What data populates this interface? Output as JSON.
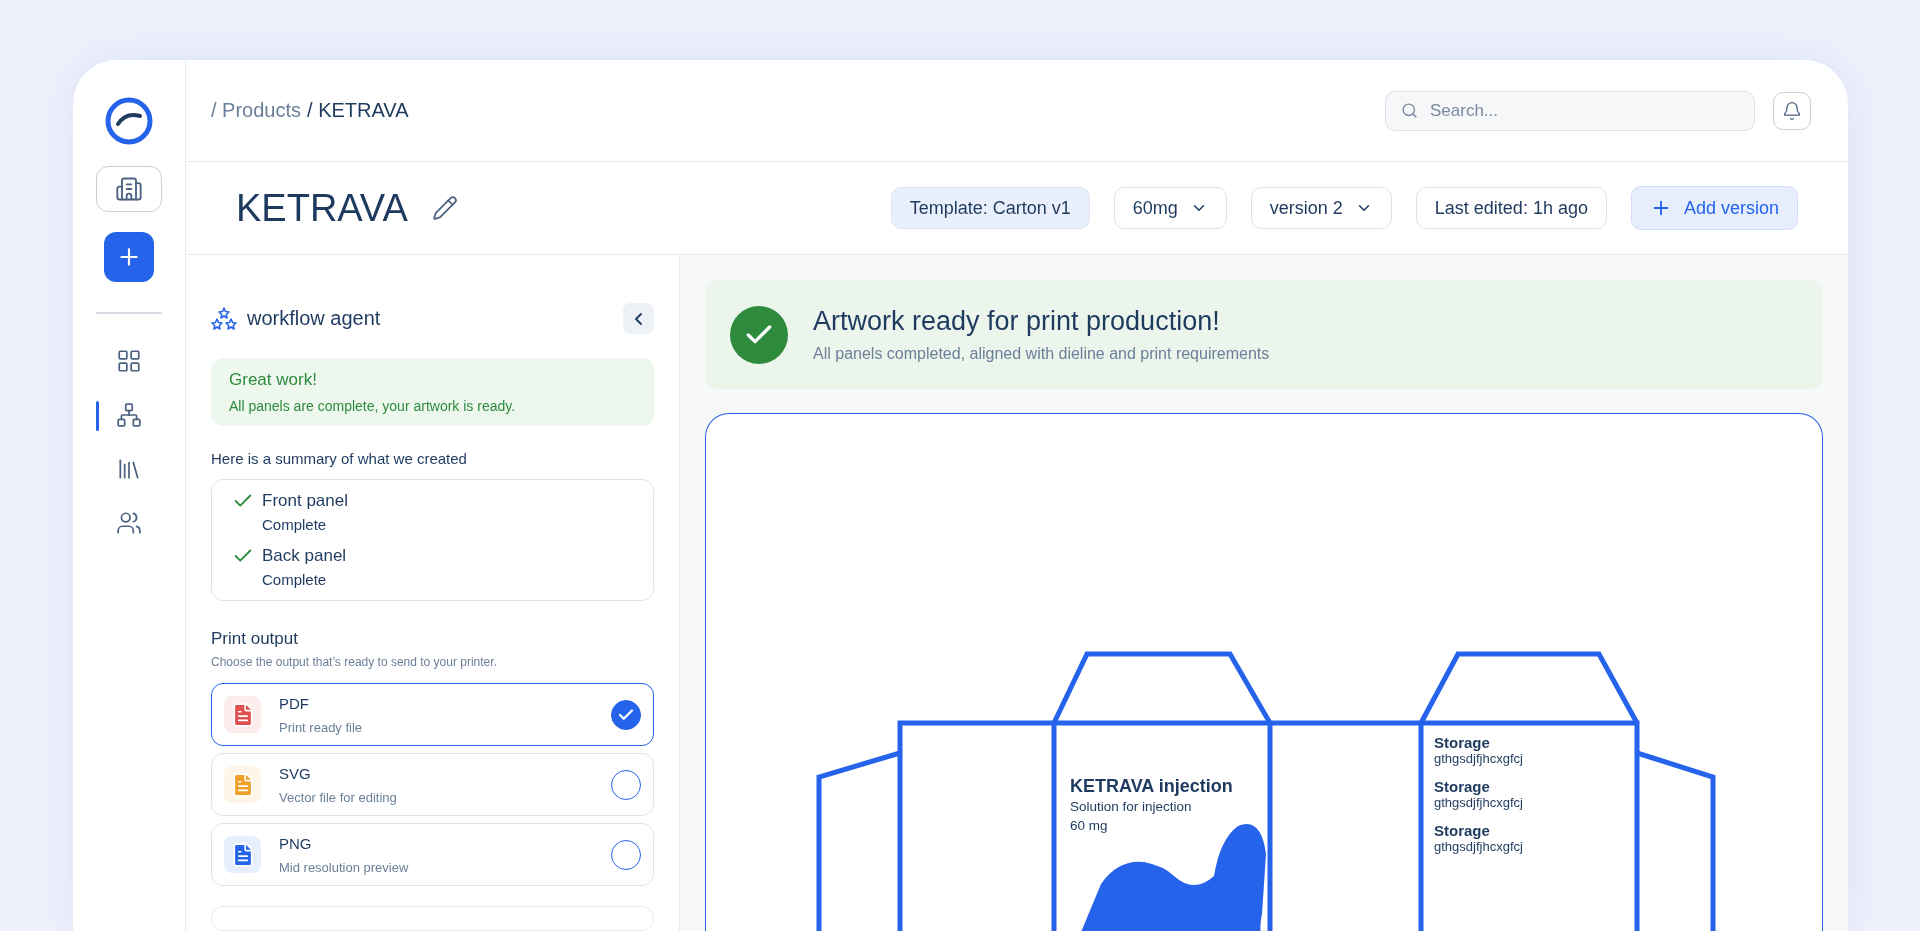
{
  "sidebar": {
    "nav": [
      {
        "kind": "grid",
        "selected": false
      },
      {
        "kind": "workflow",
        "selected": true
      },
      {
        "kind": "library",
        "selected": false
      },
      {
        "kind": "team",
        "selected": false
      }
    ]
  },
  "breadcrumb": [
    "/ Products",
    "/ KETRAVA"
  ],
  "search": {
    "placeholder": "Search..."
  },
  "product": {
    "title": "KETRAVA",
    "template": "Template: Carton v1",
    "dose": "60mg",
    "version": "version 2",
    "last_edited": "Last edited: 1h ago",
    "add_button": "Add version"
  },
  "agent": {
    "title": "workflow agent",
    "notice_title": "Great work!",
    "notice_text": "All panels are complete, your artwork is ready.",
    "summary_intro": "Here is a summary of what we created",
    "summary": [
      {
        "name": "Front panel",
        "status": "Complete"
      },
      {
        "name": "Back panel",
        "status": "Complete"
      }
    ],
    "output_title": "Print output",
    "output_hint": "Choose the output that’s ready to send to your printer.",
    "outputs": [
      {
        "name": "PDF",
        "description": "Print ready file",
        "color": "#e05252",
        "selected": true
      },
      {
        "name": "SVG",
        "description": "Vector file for editing",
        "color": "#eea029",
        "selected": false
      },
      {
        "name": "PNG",
        "description": "Mid resolution preview",
        "color": "#2563eb",
        "selected": false
      }
    ]
  },
  "banner": {
    "title": "Artwork ready for print production!",
    "text": "All panels completed, aligned with dieline and print requirements"
  },
  "dieline": {
    "front": {
      "title": "KETRAVA injection",
      "lines": [
        "Solution for injection",
        "60 mg"
      ]
    },
    "back": [
      {
        "heading": "Storage",
        "text": "gthgsdjfjhcxgfcj"
      },
      {
        "heading": "Storage",
        "text": "gthgsdjfjhcxgfcj"
      },
      {
        "heading": "Storage",
        "text": "gthgsdjfjhcxgfcj"
      }
    ]
  }
}
